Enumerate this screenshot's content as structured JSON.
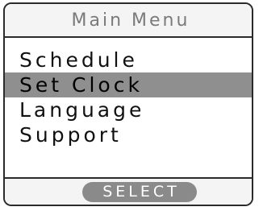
{
  "title": "Main Menu",
  "menu": {
    "items": [
      {
        "label": "Schedule",
        "selected": false
      },
      {
        "label": "Set Clock",
        "selected": true
      },
      {
        "label": "Language",
        "selected": false
      },
      {
        "label": "Support",
        "selected": false
      }
    ]
  },
  "footer": {
    "select_label": "SELECT"
  },
  "colors": {
    "border": "#2b2b2b",
    "title_text": "#7a7a7a",
    "highlight": "#8f8f8f",
    "button_bg": "#8a8a8a",
    "button_text": "#ffffff"
  }
}
